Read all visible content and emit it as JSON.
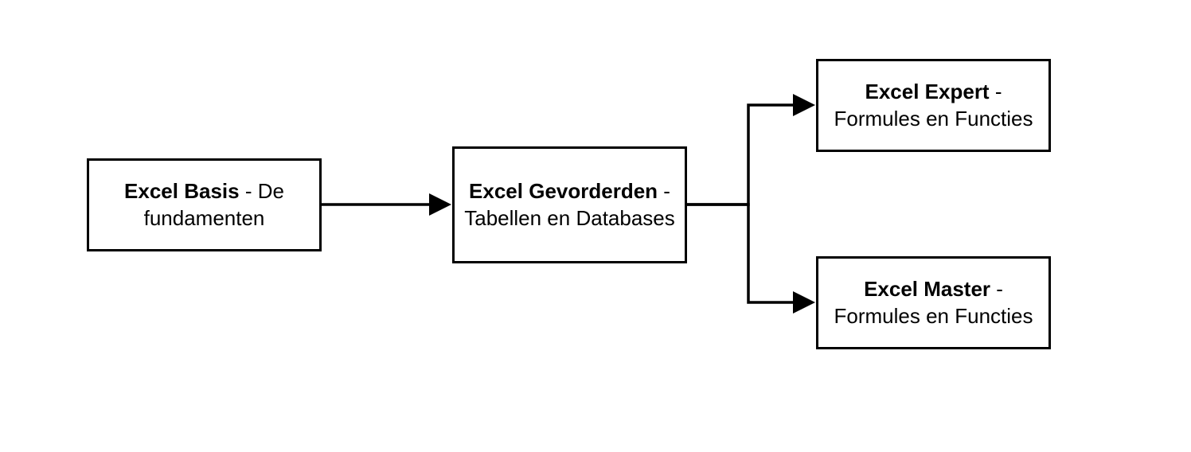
{
  "nodes": {
    "basis": {
      "title": "Excel Basis",
      "desc": " - De fundamenten"
    },
    "gevorderden": {
      "title": "Excel Gevorderden",
      "desc": " - Tabellen en Databases"
    },
    "expert": {
      "title": "Excel Expert",
      "desc": " - Formules en Functies"
    },
    "master": {
      "title": "Excel Master",
      "desc": " - Formules en Functies"
    }
  }
}
